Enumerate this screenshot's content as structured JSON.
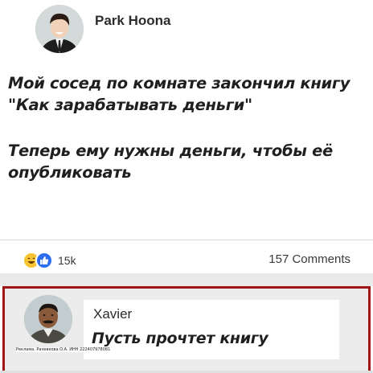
{
  "post": {
    "author": "Park Hoona",
    "text_line_1": "Мой сосед по комнате закончил книгу \"Как зарабатывать деньги\"",
    "text_line_2": "Теперь ему нужны деньги, чтобы её опубликовать"
  },
  "stats": {
    "reactions_count": "15k",
    "comments_count": "157 Comments",
    "reaction_icons": [
      "laugh-emoji",
      "like-icon"
    ]
  },
  "comment": {
    "author": "Xavier",
    "text": "Пусть прочтет книгу",
    "highlight_color": "#a01616"
  },
  "footer_note": "Реклама. Рачевкова О.А. ИНН 222407978081"
}
